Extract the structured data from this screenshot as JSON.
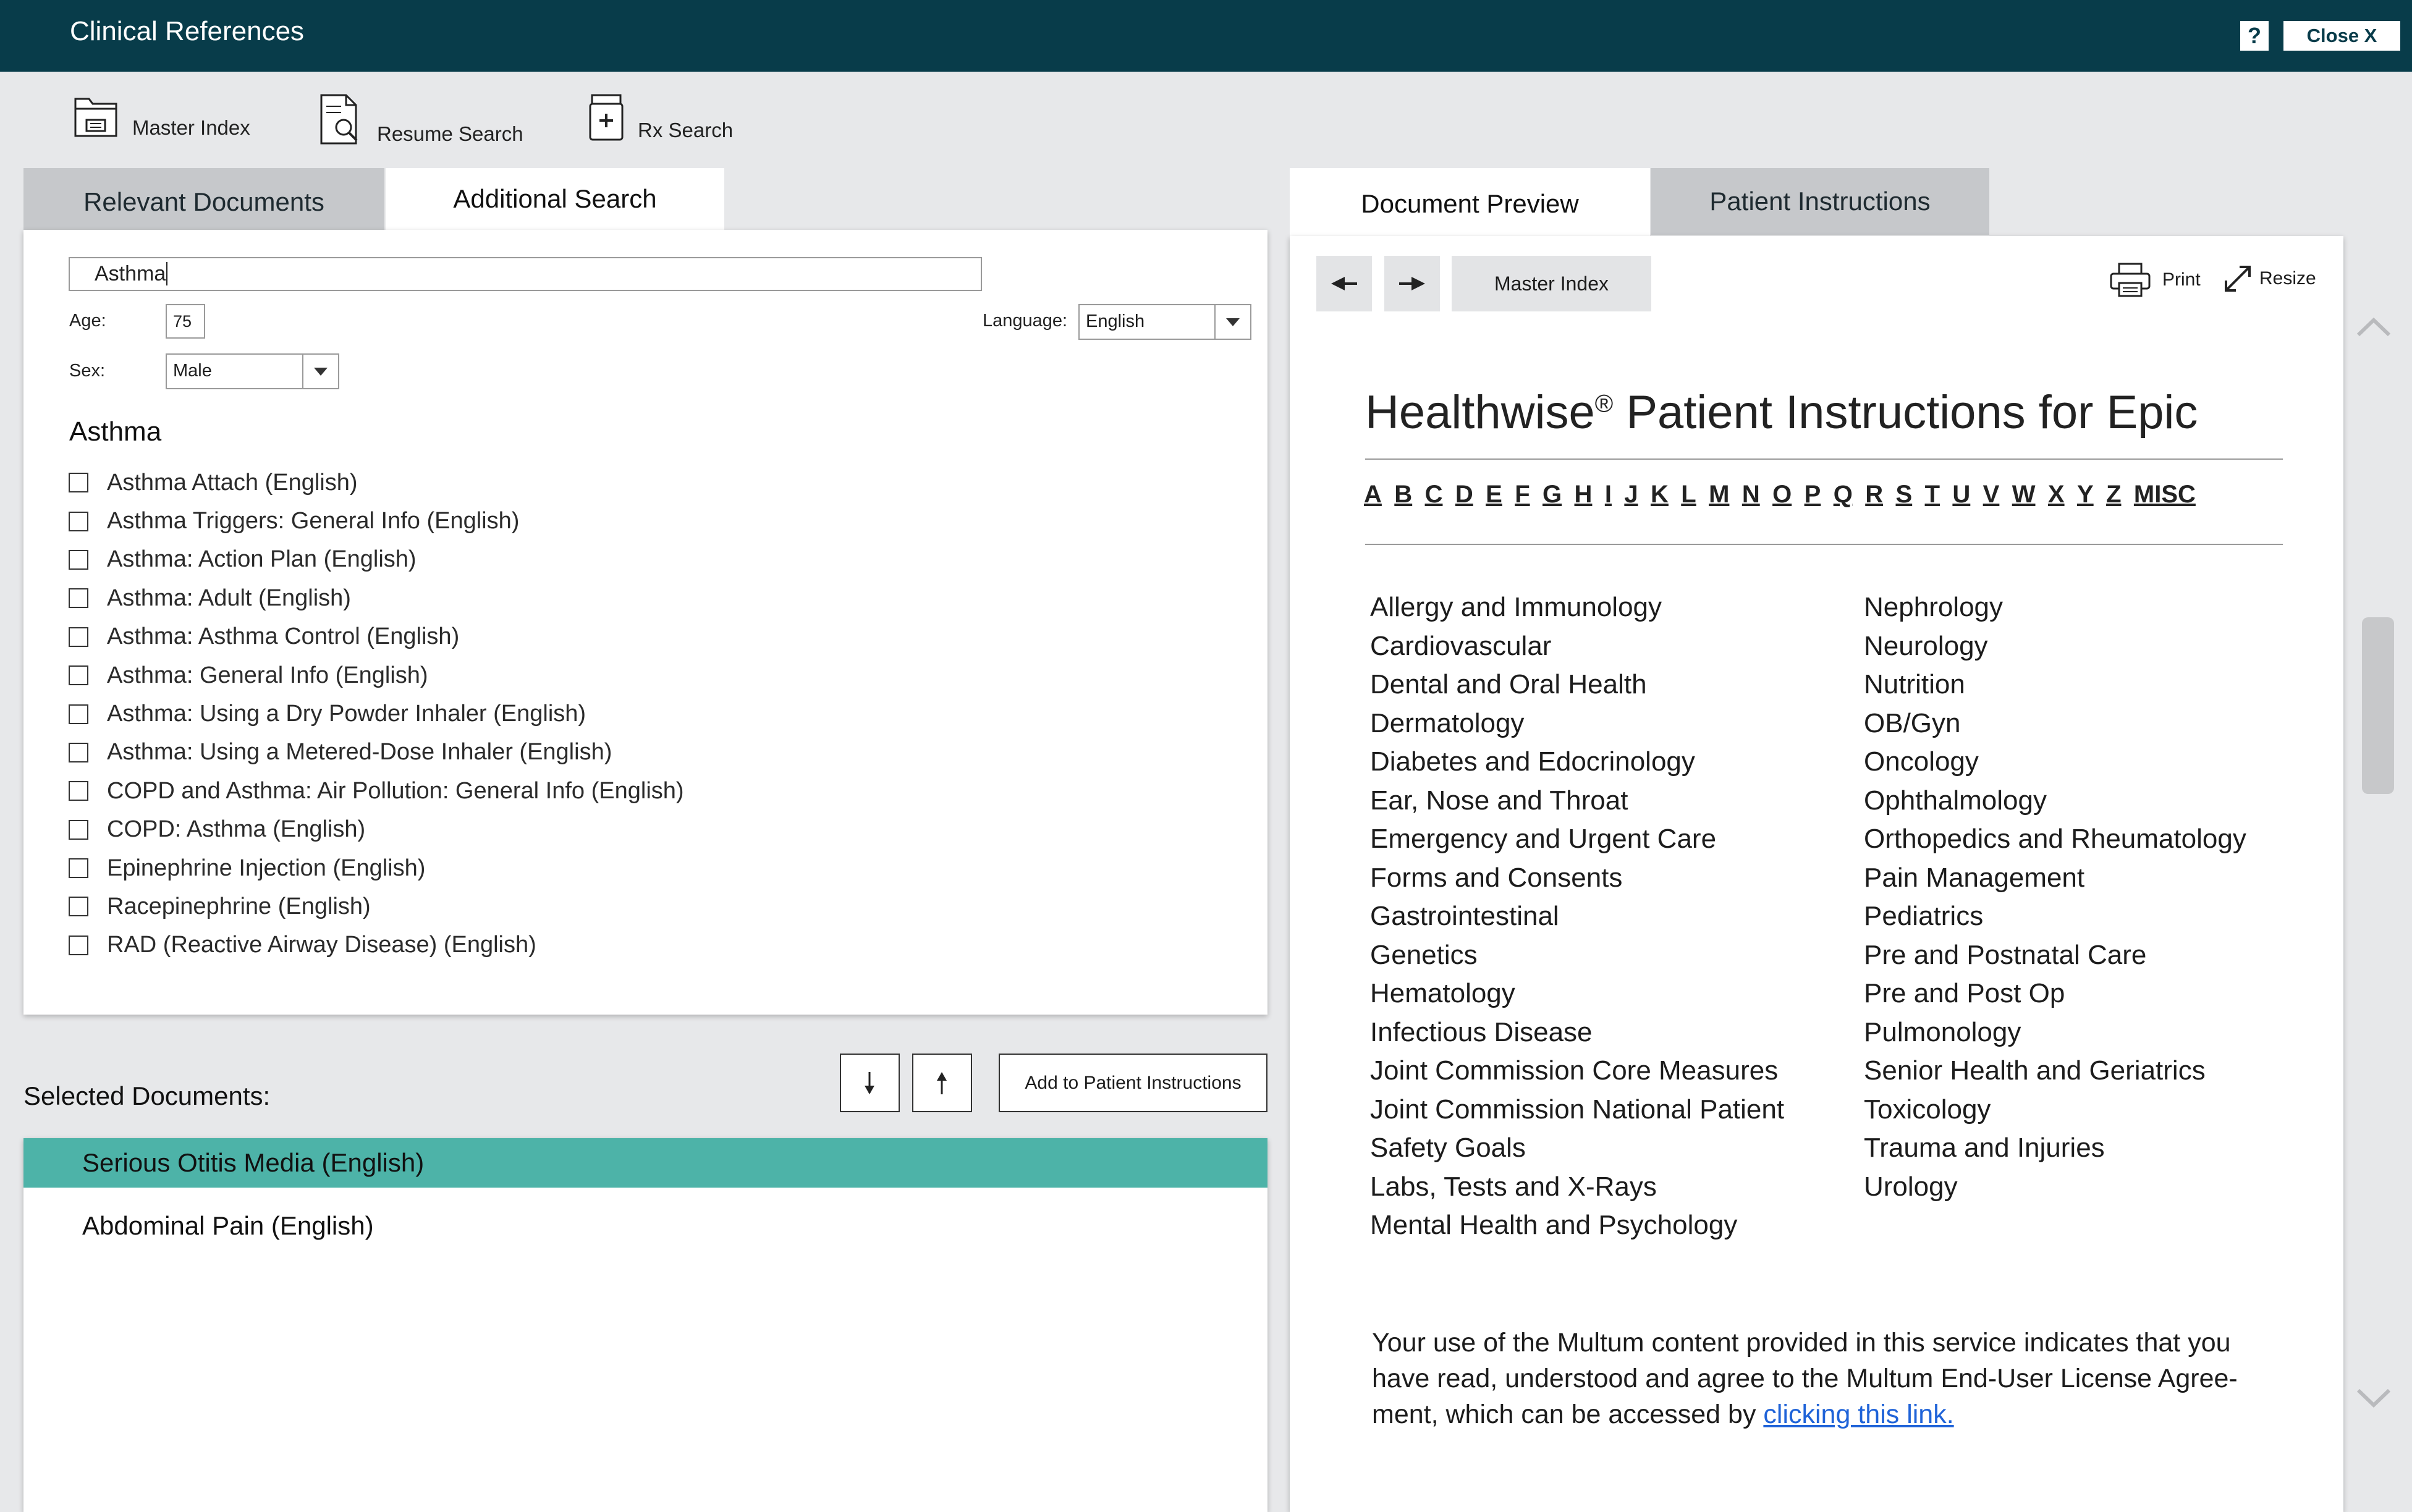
{
  "window": {
    "title": "Clinical References",
    "help_label": "?",
    "close_label": "Close  X"
  },
  "toolbar": {
    "master_index": "Master Index",
    "resume_search": "Resume Search",
    "rx_search": "Rx Search"
  },
  "left_tabs": [
    {
      "label": "Relevant Documents",
      "active": false
    },
    {
      "label": "Additional Search",
      "active": true
    }
  ],
  "search": {
    "query": "Asthma",
    "age_label": "Age:",
    "age_value": "75",
    "sex_label": "Sex:",
    "sex_value": "Male",
    "language_label": "Language:",
    "language_value": "English"
  },
  "results": {
    "heading": "Asthma",
    "items": [
      "Asthma Attach (English)",
      "Asthma Triggers: General Info (English)",
      "Asthma: Action Plan (English)",
      "Asthma: Adult (English)",
      "Asthma: Asthma Control (English)",
      "Asthma: General Info (English)",
      "Asthma: Using a Dry Powder Inhaler (English)",
      "Asthma: Using a Metered-Dose Inhaler (English)",
      "COPD and Asthma: Air Pollution: General Info (English)",
      "COPD: Asthma (English)",
      "Epinephrine Injection (English)",
      "Racepinephrine (English)",
      "RAD (Reactive Airway Disease) (English)"
    ]
  },
  "selected": {
    "label": "Selected Documents:",
    "add_button": "Add to Patient Instructions",
    "items": [
      {
        "label": "Serious Otitis Media (English)",
        "selected": true
      },
      {
        "label": "Abdominal Pain (English)",
        "selected": false
      }
    ]
  },
  "right_tabs": [
    {
      "label": "Document Preview",
      "active": true
    },
    {
      "label": "Patient Instructions",
      "active": false
    }
  ],
  "preview": {
    "back_icon": "arrow-left-icon",
    "forward_icon": "arrow-right-icon",
    "master_index": "Master Index",
    "print_label": "Print",
    "resize_label": "Resize",
    "title_main": "Healthwise",
    "title_reg": "®",
    "title_rest": " Patient Instructions for Epic",
    "alphabet": [
      "A",
      "B",
      "C",
      "D",
      "E",
      "F",
      "G",
      "H",
      "I",
      "J",
      "K",
      "L",
      "M",
      "N",
      "O",
      "P",
      "Q",
      "R",
      "S",
      "T",
      "U",
      "V",
      "W",
      "X",
      "Y",
      "Z",
      "MISC"
    ],
    "categories_left": [
      "Allergy and Immunology",
      "Cardiovascular",
      "Dental and Oral Health",
      "Dermatology",
      "Diabetes and Edocrinology",
      "Ear, Nose and Throat",
      "Emergency and Urgent Care",
      "Forms and Consents",
      "Gastrointestinal",
      "Genetics",
      "Hematology",
      "Infectious Disease",
      "Joint Commission Core Measures",
      "Joint Commission National Patient",
      "Safety Goals",
      "Labs, Tests and X-Rays",
      "Mental Health and Psychology"
    ],
    "categories_right": [
      "Nephrology",
      "Neurology",
      "Nutrition",
      "OB/Gyn",
      "Oncology",
      "Ophthalmology",
      "Orthopedics and Rheumatology",
      "Pain Management",
      "Pediatrics",
      "Pre and Postnatal Care",
      "Pre and Post Op",
      "Pulmonology",
      "Senior Health and Geriatrics",
      "Toxicology",
      "Trauma and Injuries",
      "Urology"
    ],
    "license_line1": "Your use of the Multum content provided in this service indicates that you",
    "license_line2": "have read, understood and agree to the Multum End-User License Agree-",
    "license_line3": "ment, which can  be accessed by ",
    "license_link": "clicking this link."
  },
  "colors": {
    "titlebar": "#083c4a",
    "selected_row": "#4db3a8",
    "link": "#1f63d8"
  }
}
